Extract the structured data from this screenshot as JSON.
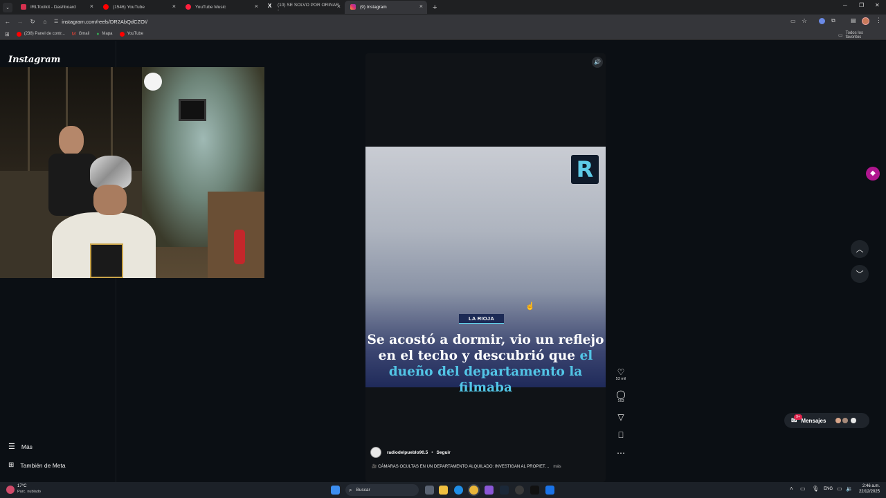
{
  "browser": {
    "tabs": [
      {
        "title": "IRLToolkit - Dashboard",
        "color": "#d6314f"
      },
      {
        "title": "(1546) YouTube",
        "color": "#ff0000"
      },
      {
        "title": "YouTube Music",
        "color": "#ff1f3d"
      },
      {
        "title": "(10) SE SOLVO POR ORINAR -",
        "color": "#ffffff"
      },
      {
        "title": "(9) Instagram",
        "color": "#e1306c"
      }
    ],
    "tab_close": "×",
    "new_tab": "+",
    "url": "instagram.com/reels/DR2AbQdCZOI/",
    "bookmarks": [
      {
        "label": "(238) Panel de contr...",
        "color": "#ff0000"
      },
      {
        "label": "Gmail",
        "color": "#ea4335"
      },
      {
        "label": "Mapa",
        "color": "#34a853"
      },
      {
        "label": "YouTube",
        "color": "#ff0000"
      }
    ],
    "all_bookmarks": "Todos los favoritos"
  },
  "instagram": {
    "logo": "Instagram",
    "sidebar": {
      "more": "Más",
      "meta": "También de Meta"
    },
    "reel": {
      "region_tag": "LA RIOJA",
      "headline_part1": "Se acostó a dormir, vio un reflejo en el techo y descubrió que ",
      "headline_highlight": "el dueño del departamento la filmaba",
      "brand_logo": "R",
      "account": "radiodelpueblo90.5",
      "separator": "•",
      "follow": "Seguir",
      "caption": "🎥 CÁMARAS OCULTAS EN UN DEPARTAMENTO ALQUILADO: INVESTIGAN AL PROPIET…",
      "more": "más",
      "likes": "53 mil",
      "comments": "163"
    },
    "messages": {
      "label": "Mensajes",
      "badge": "9+"
    }
  },
  "taskbar": {
    "weather_temp": "17°C",
    "weather_desc": "Parc. nublado",
    "search": "Buscar",
    "lang": "ENG",
    "time": "2:46 a.m.",
    "date": "22/12/2025"
  }
}
